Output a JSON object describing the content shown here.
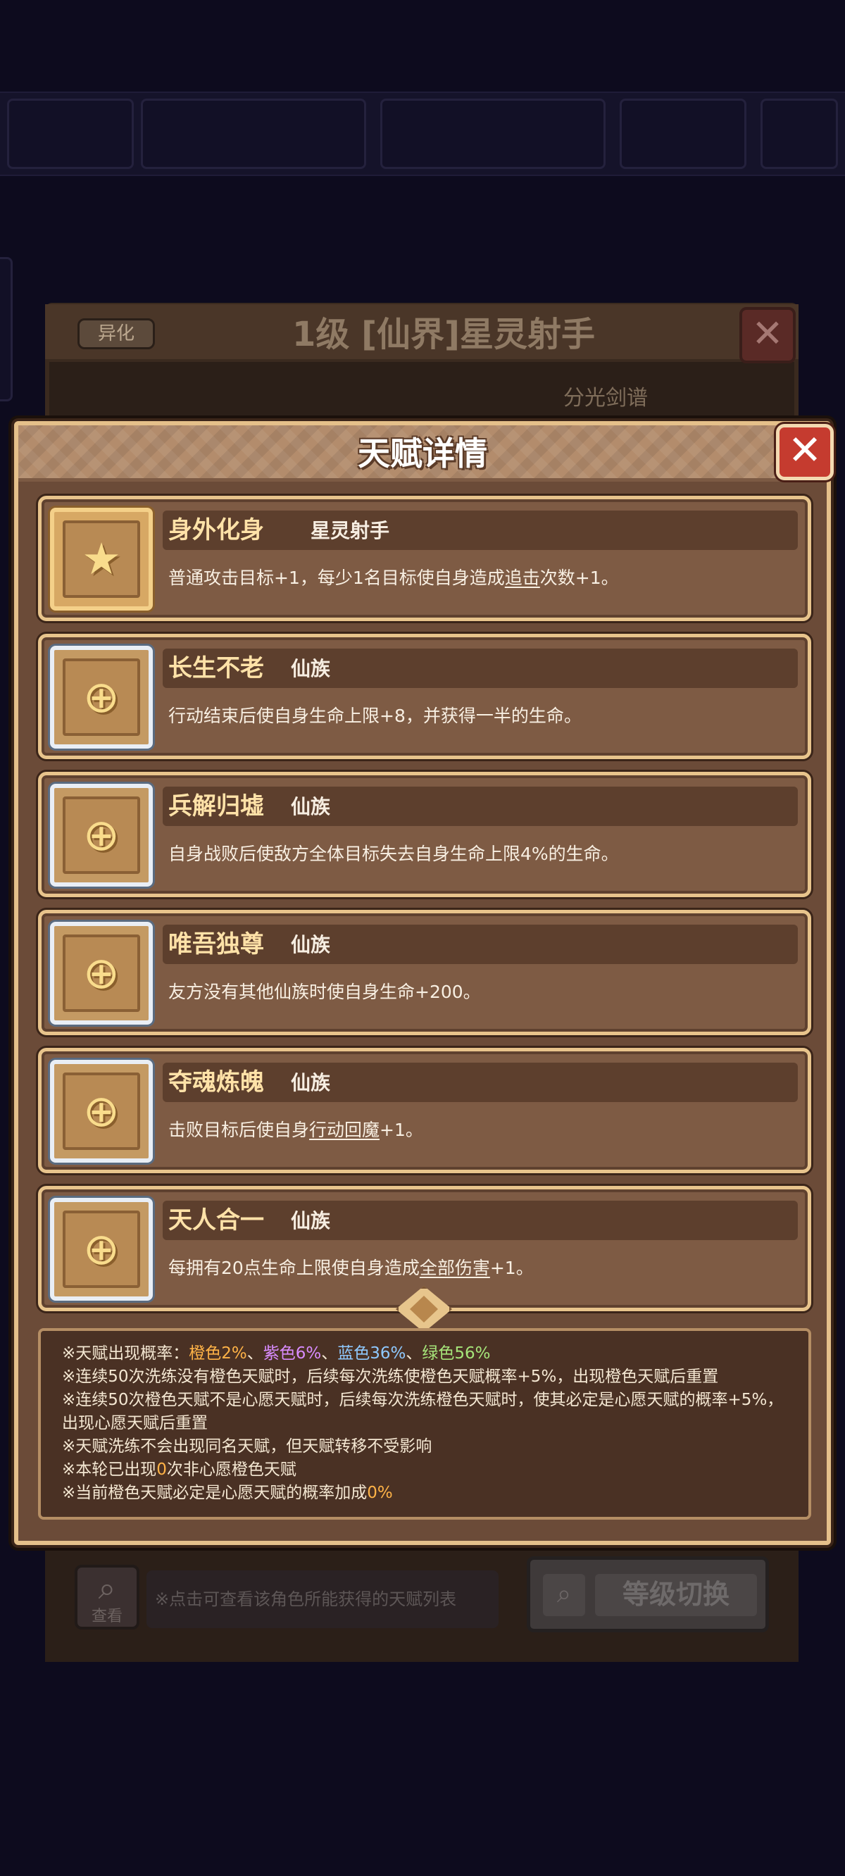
{
  "background": {
    "tag": "异化",
    "title": "1级 [仙界]星灵射手",
    "skill_label": "分光剑谱",
    "search_caption": "查看",
    "hint": "※点击可查看该角色所能获得的天赋列表",
    "level_button": "等级切换"
  },
  "dialog": {
    "title": "天赋详情",
    "close_glyph": "✕"
  },
  "talents": [
    {
      "name": "身外化身",
      "race": "星灵射手",
      "desc_pre": "普通攻击目标+1，每少1名目标使自身造成",
      "desc_link": "追击",
      "desc_post": "次数+1。",
      "icon": "star-icon",
      "glyph": "★",
      "tier": "gold"
    },
    {
      "name": "长生不老",
      "race": "仙族",
      "desc_pre": "行动结束后使自身生命上限+8，并获得一半的生命。",
      "desc_link": "",
      "desc_post": "",
      "icon": "emblem-icon",
      "glyph": "⊕",
      "tier": "silver"
    },
    {
      "name": "兵解归墟",
      "race": "仙族",
      "desc_pre": "自身战败后使敌方全体目标失去自身生命上限4%的生命。",
      "desc_link": "",
      "desc_post": "",
      "icon": "emblem-icon",
      "glyph": "⊕",
      "tier": "silver"
    },
    {
      "name": "唯吾独尊",
      "race": "仙族",
      "desc_pre": "友方没有其他仙族时使自身生命+200。",
      "desc_link": "",
      "desc_post": "",
      "icon": "emblem-icon",
      "glyph": "⊕",
      "tier": "silver"
    },
    {
      "name": "夺魂炼魄",
      "race": "仙族",
      "desc_pre": "击败目标后使自身",
      "desc_link": "行动回魔",
      "desc_post": "+1。",
      "icon": "emblem-icon",
      "glyph": "⊕",
      "tier": "silver"
    },
    {
      "name": "天人合一",
      "race": "仙族",
      "desc_pre": "每拥有20点生命上限使自身造成",
      "desc_link": "全部伤害",
      "desc_post": "+1。",
      "icon": "emblem-icon",
      "glyph": "⊕",
      "tier": "silver"
    }
  ],
  "info": {
    "prob_label": "※天赋出现概率：",
    "orange": "橙色2%",
    "sep1": "、",
    "purple": "紫色6%",
    "sep2": "、",
    "blue": "蓝色36%",
    "sep3": "、",
    "green": "绿色56%",
    "line2": "※连续50次洗练没有橙色天赋时，后续每次洗练使橙色天赋概率+5%，出现橙色天赋后重置",
    "line3": "※连续50次橙色天赋不是心愿天赋时，后续每次洗练橙色天赋时，使其必定是心愿天赋的概率+5%，出现心愿天赋后重置",
    "line4": "※天赋洗练不会出现同名天赋，但天赋转移不受影响",
    "line5_pre": "※本轮已出现",
    "line5_num": "0",
    "line5_post": "次非心愿橙色天赋",
    "line6_pre": "※当前橙色天赋必定是心愿天赋的概率加成",
    "line6_num": "0%"
  },
  "colors": {
    "accent_gold": "#e8c48c",
    "panel_brown": "#6b4b38",
    "close_red": "#c53b2f",
    "orange": "#ffb347",
    "purple": "#d98cff",
    "blue": "#8fc9ff",
    "green": "#a6e57a"
  }
}
